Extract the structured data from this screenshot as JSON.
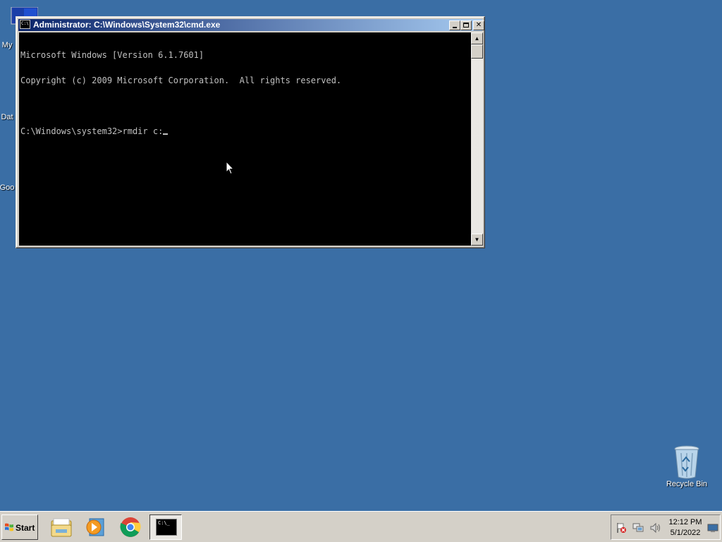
{
  "desktop": {
    "background": "#3a6ea5",
    "icons": [
      {
        "label": "My",
        "icon": "computer-icon"
      },
      {
        "label": "Dat",
        "icon": "shortcut-icon"
      },
      {
        "label": "Goo",
        "icon": "shortcut-icon"
      },
      {
        "label": "Recycle Bin",
        "icon": "recycle-bin-icon"
      }
    ]
  },
  "cmd_window": {
    "title": "Administrator: C:\\Windows\\System32\\cmd.exe",
    "icon_text": "C:\\",
    "lines": [
      "Microsoft Windows [Version 6.1.7601]",
      "Copyright (c) 2009 Microsoft Corporation.  All rights reserved.",
      "",
      "C:\\Windows\\system32>rmdir c:"
    ]
  },
  "taskbar": {
    "start_label": "Start",
    "buttons": [
      {
        "name": "explorer",
        "icon": "folder-icon"
      },
      {
        "name": "media-player",
        "icon": "media-player-icon"
      },
      {
        "name": "chrome",
        "icon": "chrome-icon"
      },
      {
        "name": "cmd",
        "icon": "cmd-icon",
        "text": "C:\\_",
        "active": true
      }
    ],
    "clock": {
      "time": "12:12 PM",
      "date": "5/1/2022"
    },
    "tray_icons": [
      "action-center-flag-icon",
      "network-icon",
      "volume-icon",
      "show-desktop-icon"
    ]
  }
}
